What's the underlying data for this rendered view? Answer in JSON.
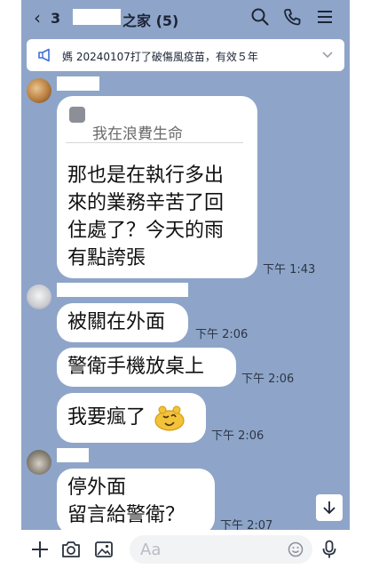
{
  "header": {
    "back_count": "3",
    "room_name": "之家 (5)",
    "icons": [
      "search-icon",
      "phone-icon",
      "menu-icon"
    ]
  },
  "announcement": {
    "text": "媽 20240107打了破傷風疫苗，有效５年"
  },
  "messages": [
    {
      "quote": "我在浪費生命",
      "lines": [
        "那也是在執行多出",
        "來的業務辛苦了回",
        "住處了？今天的雨",
        "有點誇張"
      ],
      "time": "下午 1:43"
    },
    {
      "text": "被關在外面",
      "time": "下午 2:06"
    },
    {
      "text": "警衛手機放桌上",
      "time": "下午 2:06"
    },
    {
      "text": "我要瘋了",
      "time": "下午 2:06",
      "emoji": "crazy-face"
    },
    {
      "lines": [
        "停外面",
        "留言給警衛？"
      ],
      "time": "下午 2:07"
    }
  ],
  "input": {
    "placeholder": "Aa"
  },
  "colors": {
    "chat_background": "#8ea5c9",
    "bubble": "#ffffff"
  }
}
